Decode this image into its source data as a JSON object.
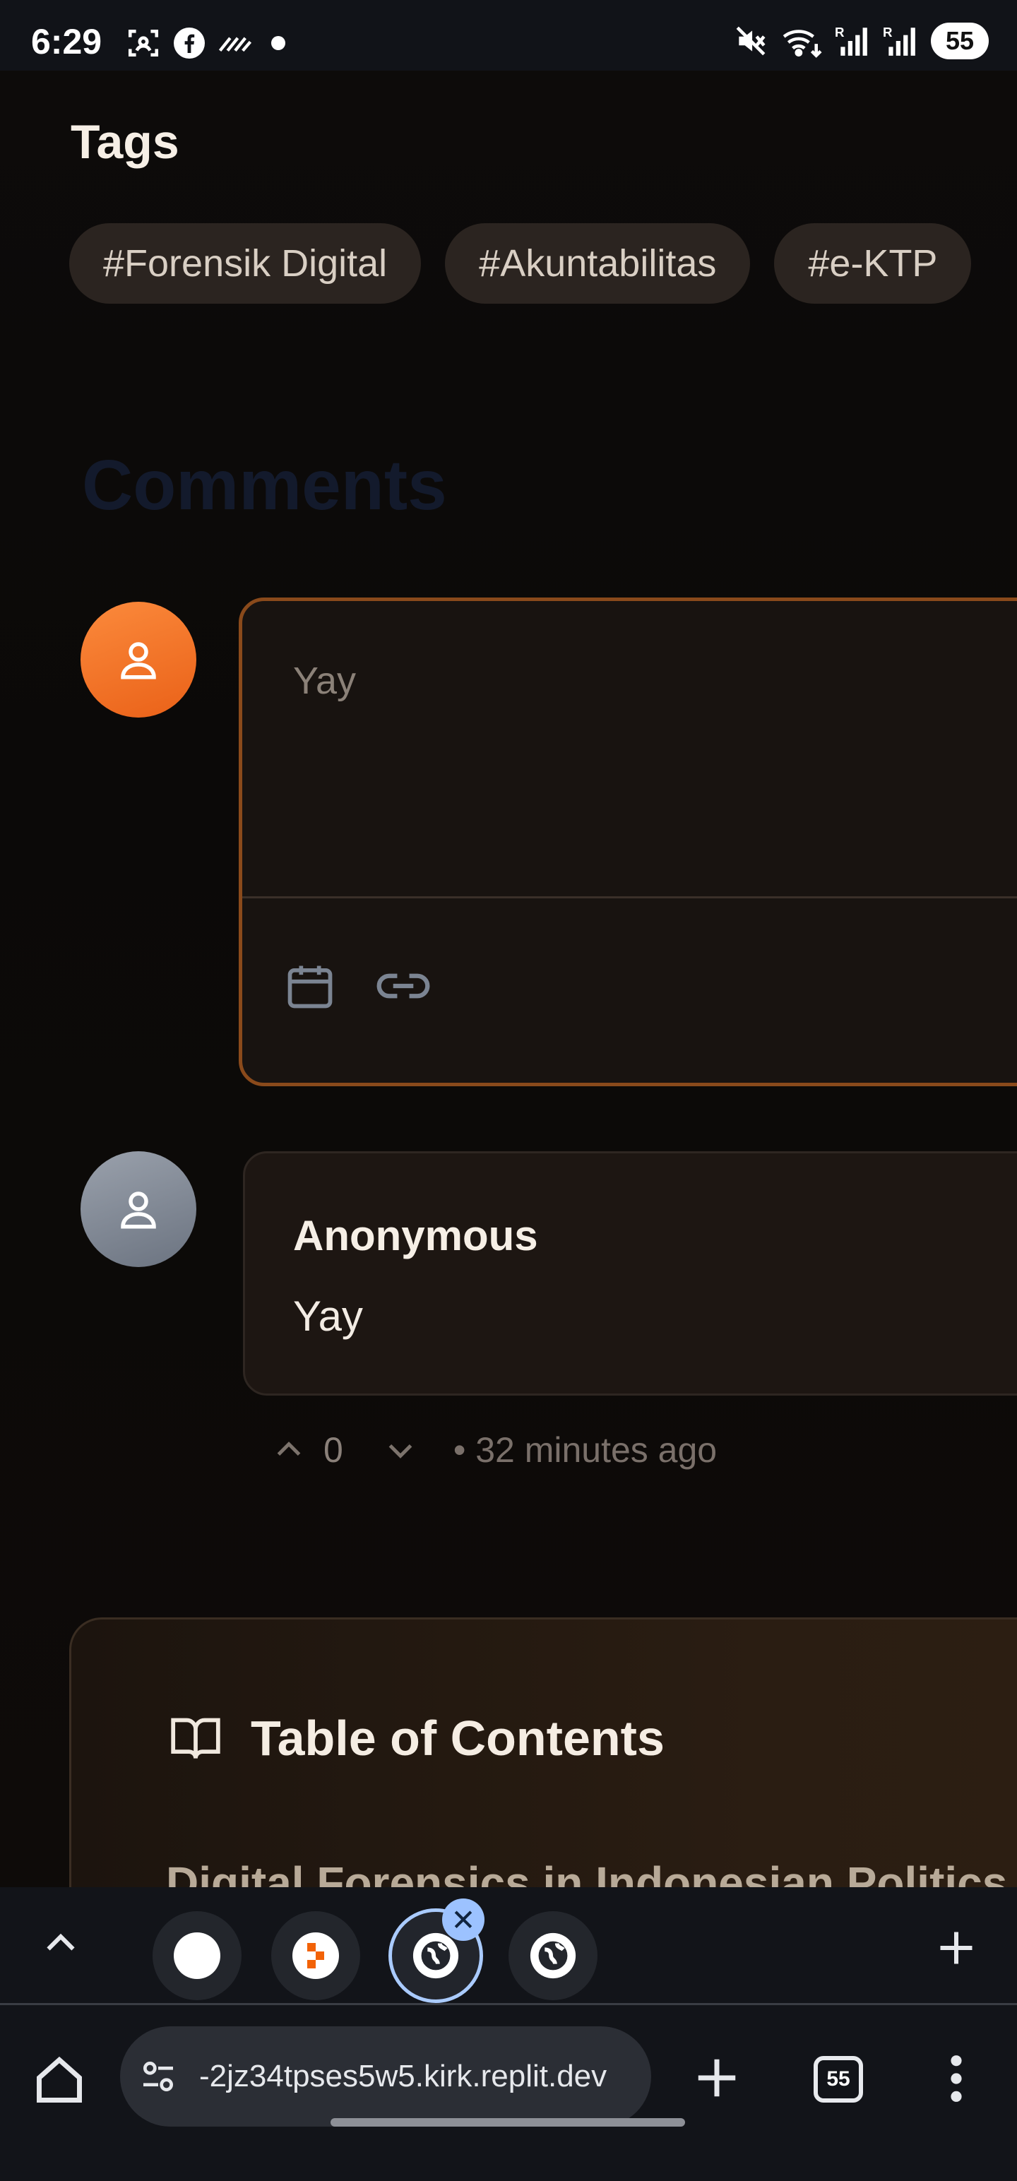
{
  "status_bar": {
    "time": "6:29",
    "battery": "55",
    "left_icons": [
      "screenshot-icon",
      "facebook-icon",
      "signal-hatch-icon",
      "dot-icon"
    ],
    "right_icons": [
      "mute-icon",
      "wifi-icon",
      "signal-r-icon",
      "signal-r-icon"
    ]
  },
  "tags": {
    "heading": "Tags",
    "items": [
      "#Forensik Digital",
      "#Akuntabilitas",
      "#e-KTP"
    ]
  },
  "comments": {
    "heading": "Comments",
    "editor": {
      "text": "Yay",
      "tools": [
        "calendar-icon",
        "link-icon"
      ]
    },
    "list": [
      {
        "author": "Anonymous",
        "body": "Yay",
        "votes": "0",
        "time": "• 32 minutes ago"
      }
    ]
  },
  "toc": {
    "title": "Table of Contents",
    "first_item": "Digital Forensics in Indonesian Politics"
  },
  "browser": {
    "url": "-2jz34tpses5w5.kirk.replit.dev",
    "tab_count": "55",
    "tab_close_glyph": "✕",
    "accent": "#aacbff"
  },
  "colors": {
    "brand_orange": "#f97a2e",
    "editor_border": "#8a4a1b",
    "background": "#0b0908"
  }
}
